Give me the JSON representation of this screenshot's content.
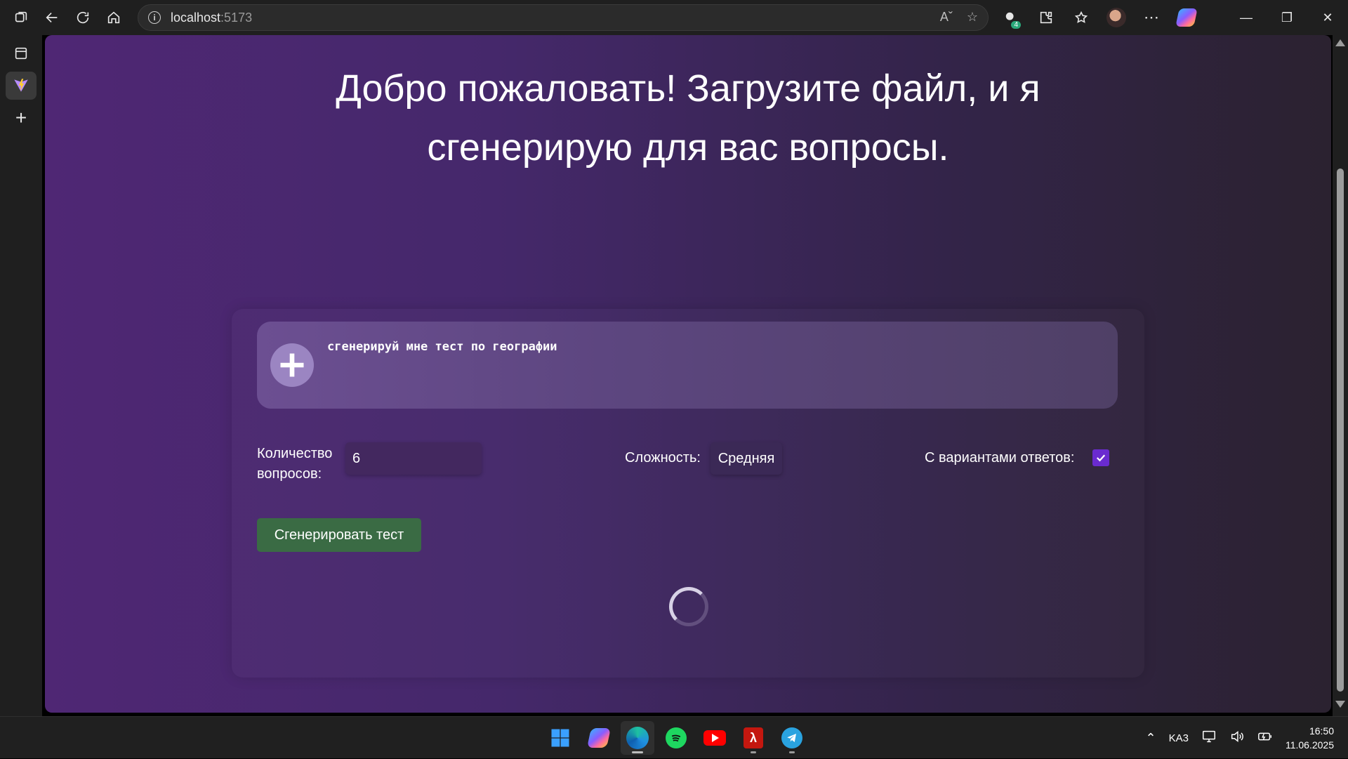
{
  "browser": {
    "url_host": "localhost",
    "url_port": ":5173",
    "extensions_badge": "4"
  },
  "page": {
    "headline_line1": "Добро пожаловать! Загрузите файл, и я",
    "headline_line2": "сгенерирую для вас вопросы.",
    "prompt_text": "сгенерируй мне тест по географии",
    "count_label_line1": "Количество",
    "count_label_line2": "вопросов:",
    "count_value": "6",
    "difficulty_label": "Сложность:",
    "difficulty_value": "Средняя",
    "options_label": "С вариантами ответов:",
    "options_checked": true,
    "generate_button": "Сгенерировать тест"
  },
  "taskbar": {
    "language": "KA3",
    "time": "16:50",
    "date": "11.06.2025"
  },
  "colors": {
    "page_gradient_start": "#4f2774",
    "page_gradient_end": "#2b2230",
    "button_green": "#3a6b44",
    "checkbox_purple": "#6a2bd0"
  }
}
